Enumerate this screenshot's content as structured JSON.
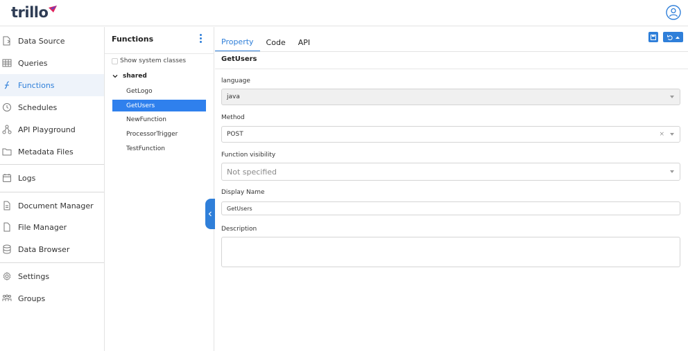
{
  "app": {
    "logo_text": "trillo",
    "logo_icon": "trillo-mark-icon",
    "user_icon": "user-avatar-icon"
  },
  "colors": {
    "accent": "#2f7fd9",
    "selected": "#2f80ed",
    "logo": "#2f3d55"
  },
  "sidebar": {
    "items": [
      {
        "label": "Data Source",
        "icon": "data-source-icon"
      },
      {
        "label": "Queries",
        "icon": "table-icon"
      },
      {
        "label": "Functions",
        "icon": "function-icon",
        "active": true
      },
      {
        "label": "Schedules",
        "icon": "clock-icon"
      },
      {
        "label": "API Playground",
        "icon": "api-icon"
      },
      {
        "label": "Metadata Files",
        "icon": "folder-icon"
      },
      {
        "label": "Logs",
        "icon": "logs-icon"
      },
      {
        "label": "Document Manager",
        "icon": "document-icon"
      },
      {
        "label": "File Manager",
        "icon": "file-icon"
      },
      {
        "label": "Data Browser",
        "icon": "database-icon"
      },
      {
        "label": "Settings",
        "icon": "gear-icon"
      },
      {
        "label": "Groups",
        "icon": "groups-icon"
      }
    ]
  },
  "functions_panel": {
    "title": "Functions",
    "show_system_classes": "Show system classes",
    "folder": "shared",
    "items": [
      "GetLogo",
      "GetUsers",
      "NewFunction",
      "ProcessorTrigger",
      "TestFunction"
    ],
    "selected": "GetUsers"
  },
  "main": {
    "tabs": [
      "Property",
      "Code",
      "API"
    ],
    "active_tab": "Property",
    "function_name": "GetUsers",
    "fields": {
      "language_label": "language",
      "language_value": "java",
      "method_label": "Method",
      "method_value": "POST",
      "method_clear": "×",
      "visibility_label": "Function visibility",
      "visibility_placeholder": "Not specified",
      "display_name_label": "Display Name",
      "display_name_value": "GetUsers",
      "description_label": "Description",
      "description_value": ""
    }
  }
}
